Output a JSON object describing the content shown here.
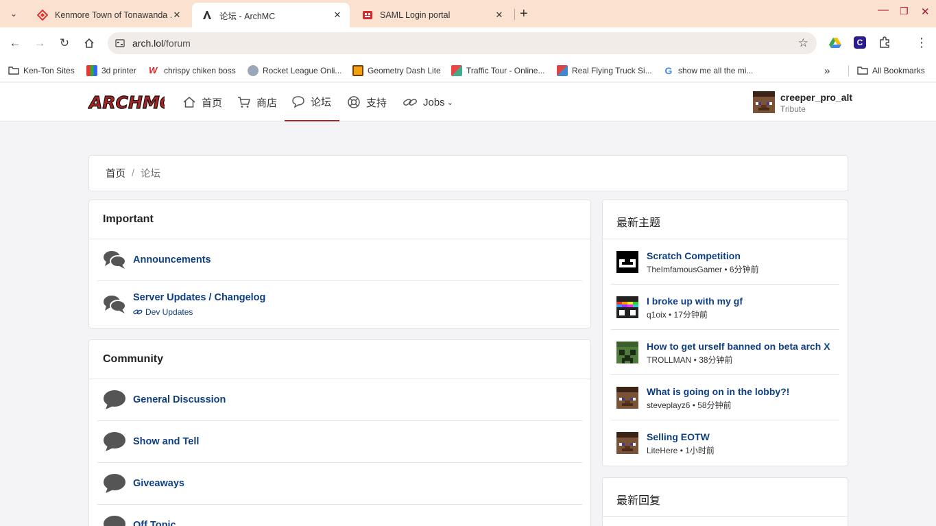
{
  "browser": {
    "tabs": [
      {
        "title": "Kenmore Town of Tonawanda ..."
      },
      {
        "title": "论坛 - ArchMC"
      },
      {
        "title": "SAML Login portal"
      }
    ],
    "url_host": "arch.lol",
    "url_path": "/forum",
    "bookmarks": [
      {
        "label": "Ken-Ton Sites"
      },
      {
        "label": "3d printer"
      },
      {
        "label": "chrispy chiken boss"
      },
      {
        "label": "Rocket League Onli..."
      },
      {
        "label": "Geometry Dash Lite"
      },
      {
        "label": "Traffic Tour - Online..."
      },
      {
        "label": "Real Flying Truck Si..."
      },
      {
        "label": "show me all the mi..."
      }
    ],
    "all_bookmarks": "All Bookmarks"
  },
  "site": {
    "logo_text": "ARCHMC",
    "nav": [
      {
        "label": "首页",
        "icon": "home-icon"
      },
      {
        "label": "商店",
        "icon": "cart-icon"
      },
      {
        "label": "论坛",
        "icon": "chat-icon"
      },
      {
        "label": "支持",
        "icon": "lifebuoy-icon"
      },
      {
        "label": "Jobs",
        "icon": "link-icon"
      }
    ],
    "user": {
      "name": "creeper_pro_alt",
      "rank": "Tribute"
    }
  },
  "breadcrumb": {
    "home": "首页",
    "sep": "/",
    "current": "论坛"
  },
  "sections": [
    {
      "title": "Important",
      "forums": [
        {
          "title": "Announcements"
        },
        {
          "title": "Server Updates / Changelog",
          "sub": "Dev Updates"
        }
      ]
    },
    {
      "title": "Community",
      "forums": [
        {
          "title": "General Discussion"
        },
        {
          "title": "Show and Tell"
        },
        {
          "title": "Giveaways"
        },
        {
          "title": "Off Topic"
        }
      ]
    }
  ],
  "latest_topics": {
    "title": "最新主题",
    "items": [
      {
        "title": "Scratch Competition",
        "meta": "TheImfamousGamer • 6分钟前"
      },
      {
        "title": "I broke up with my gf",
        "meta": "q1oix • 17分钟前"
      },
      {
        "title": "How to get urself banned on beta arch X",
        "meta": "TROLLMAN • 38分钟前"
      },
      {
        "title": "What is going on in the lobby?!",
        "meta": "steveplayz6 • 58分钟前"
      },
      {
        "title": "Selling EOTW",
        "meta": "LiteHere • 1小时前"
      }
    ]
  },
  "latest_replies": {
    "title": "最新回复"
  },
  "colors": {
    "accent": "#a82424",
    "link": "#0f3f82",
    "tabstrip": "#fbe2d0"
  }
}
